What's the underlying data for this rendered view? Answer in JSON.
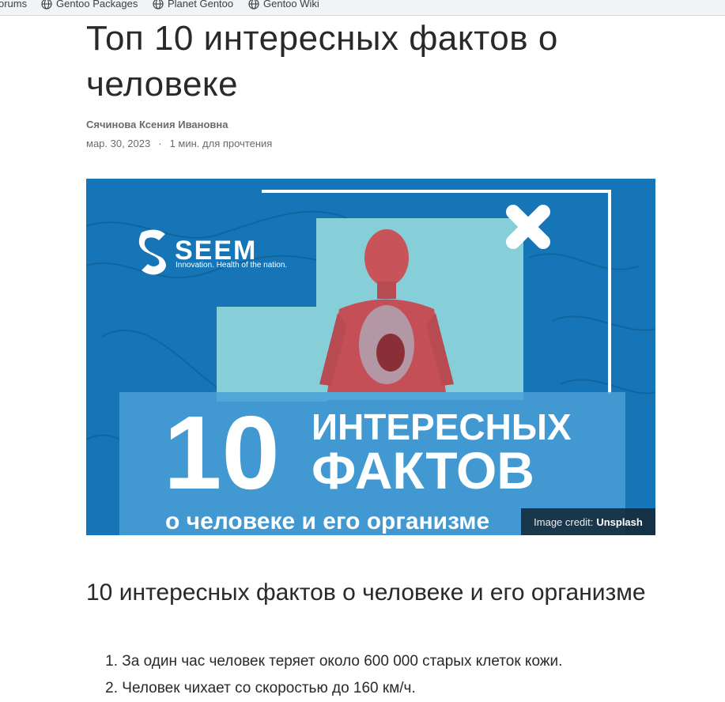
{
  "bookmarks": [
    {
      "label": "orums",
      "icon": "globe-icon"
    },
    {
      "label": "Gentoo Packages",
      "icon": "globe-icon"
    },
    {
      "label": "Planet Gentoo",
      "icon": "globe-icon"
    },
    {
      "label": "Gentoo Wiki",
      "icon": "globe-icon"
    }
  ],
  "article": {
    "title": "Топ 10 интересных фактов о человеке",
    "author": "Сячинова Ксения Ивановна",
    "date": "мар. 30, 2023",
    "separator": "·",
    "read_time": "1 мин. для прочтения",
    "hero": {
      "brand": "SEEM",
      "tagline": "Innovation. Health of the nation.",
      "big_number": "10",
      "line1": "ИНТЕРЕСНЫХ",
      "line2": "ФАКТОВ",
      "line3": "о человеке и его организме",
      "credit_prefix": "Image credit:",
      "credit_source": "Unsplash"
    },
    "subtitle": "10 интересных фактов о человеке и его организме",
    "facts": [
      {
        "num": "1.",
        "text": "За один час человек теряет около 600 000 старых клеток кожи."
      },
      {
        "num": "2.",
        "text": "Человек чихает со скоростью до 160 км/ч."
      }
    ]
  },
  "colors": {
    "hero_bg": "#1575b6",
    "hero_panel": "#86cfd8",
    "text": "#292929",
    "meta": "#6b6b6b"
  }
}
